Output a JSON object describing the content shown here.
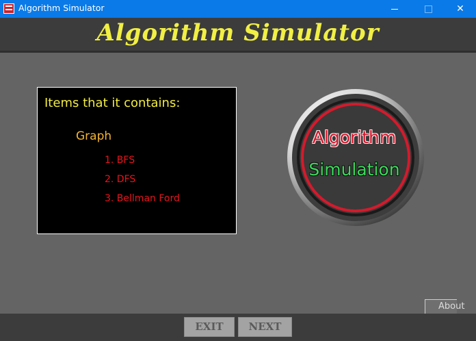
{
  "window": {
    "title": "Algorithm Simulator",
    "controls": {
      "minimize": "minimize",
      "maximize": "maximize",
      "close": "✕"
    }
  },
  "header": {
    "title": "Algorithm Simulator"
  },
  "panel": {
    "heading": "Items that it contains:",
    "section_title": "Graph",
    "items": [
      "1. BFS",
      "2. DFS",
      "3. Bellman Ford"
    ]
  },
  "logo": {
    "line1": "Algorithm",
    "line2": "Simulation"
  },
  "buttons": {
    "about": "About",
    "exit": "EXIT",
    "next": "NEXT"
  },
  "colors": {
    "titlebar": "#0a7ae8",
    "banner_text": "#f1ef43",
    "heading": "#f3ed3f",
    "section": "#f3b533",
    "list_items": "#e8141b",
    "logo_line1": "#d8152a",
    "logo_line2": "#3bd85a"
  }
}
